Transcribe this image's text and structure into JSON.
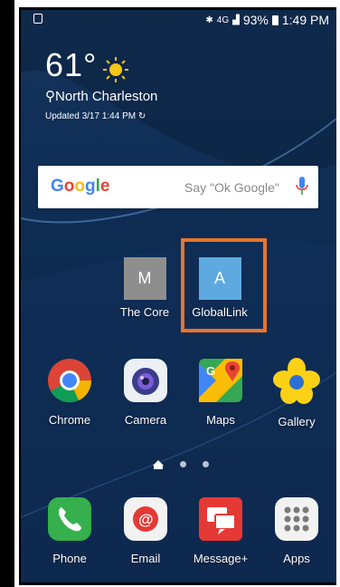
{
  "status_bar": {
    "network": "4G",
    "battery": "93%",
    "time": "1:49 PM"
  },
  "weather": {
    "temperature": "61°",
    "location": "North Charleston",
    "updated": "Updated 3/17 1:44 PM"
  },
  "search": {
    "brand": "Google",
    "hint": "Say \"Ok Google\""
  },
  "folder_apps": [
    {
      "letter": "M",
      "label": "The Core",
      "color": "#8e8e8e"
    },
    {
      "letter": "A",
      "label": "GlobalLink",
      "color": "#5ea9e0"
    }
  ],
  "apps_row": [
    {
      "label": "Chrome"
    },
    {
      "label": "Camera"
    },
    {
      "label": "Maps"
    },
    {
      "label": "Gallery"
    }
  ],
  "dock": [
    {
      "label": "Phone"
    },
    {
      "label": "Email"
    },
    {
      "label": "Message+"
    },
    {
      "label": "Apps"
    }
  ],
  "colors": {
    "highlight": "#e8742a",
    "accent": "#2b6fd6"
  }
}
